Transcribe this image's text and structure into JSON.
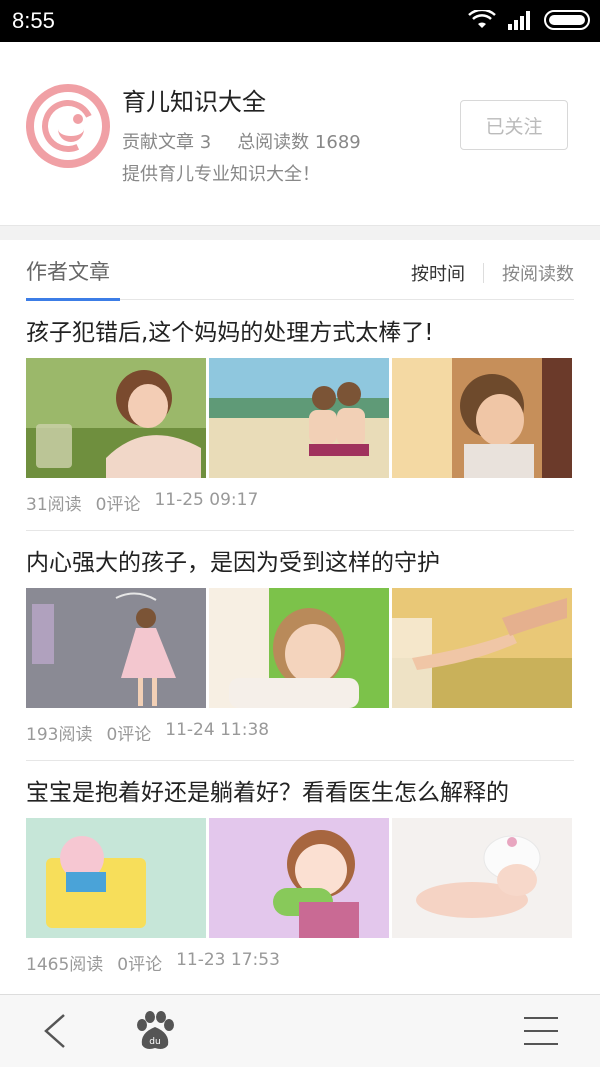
{
  "status_bar": {
    "time": "8:55"
  },
  "profile": {
    "name": "育儿知识大全",
    "articles_label": "贡献文章 3",
    "reads_label": "总阅读数 1689",
    "description": "提供育儿专业知识大全！",
    "follow_button": "已关注"
  },
  "tabs": {
    "author_articles": "作者文章",
    "sort_by_time": "按时间",
    "sort_by_reads": "按阅读数"
  },
  "articles": [
    {
      "title": "孩子犯错后,这个妈妈的处理方式太棒了!",
      "reads": "31阅读",
      "comments": "0评论",
      "time": "11-25 09:17"
    },
    {
      "title": "内心强大的孩子，是因为受到这样的守护",
      "reads": "193阅读",
      "comments": "0评论",
      "time": "11-24 11:38"
    },
    {
      "title": "宝宝是抱着好还是躺着好？看看医生怎么解释的",
      "reads": "1465阅读",
      "comments": "0评论",
      "time": "11-23 17:53"
    }
  ],
  "colors": {
    "accent": "#3c7de6",
    "avatar": "#f0a0a5"
  }
}
